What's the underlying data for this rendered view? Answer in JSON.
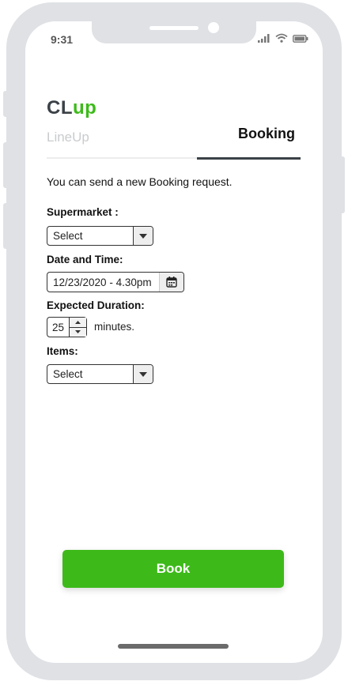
{
  "status_bar": {
    "time": "9:31"
  },
  "app": {
    "logo_part1": "CL",
    "logo_part2": "up"
  },
  "tabs": [
    {
      "label": "LineUp",
      "active": false
    },
    {
      "label": "Booking",
      "active": true
    }
  ],
  "form": {
    "intro": "You can send a new Booking request.",
    "supermarket": {
      "label": "Supermarket :",
      "value": "Select"
    },
    "datetime": {
      "label": "Date and Time:",
      "value": "12/23/2020 - 4.30pm"
    },
    "duration": {
      "label": "Expected Duration:",
      "value": "25",
      "unit": "minutes."
    },
    "items": {
      "label": "Items:",
      "value": "Select"
    }
  },
  "book_button": {
    "label": "Book"
  },
  "colors": {
    "brand_green": "#3dba1a",
    "brand_dark": "#3b4147",
    "frame": "#dfe1e5"
  },
  "icons": [
    "signal-icon",
    "wifi-icon",
    "battery-icon",
    "chevron-down-icon",
    "calendar-icon",
    "chevron-up-icon"
  ]
}
